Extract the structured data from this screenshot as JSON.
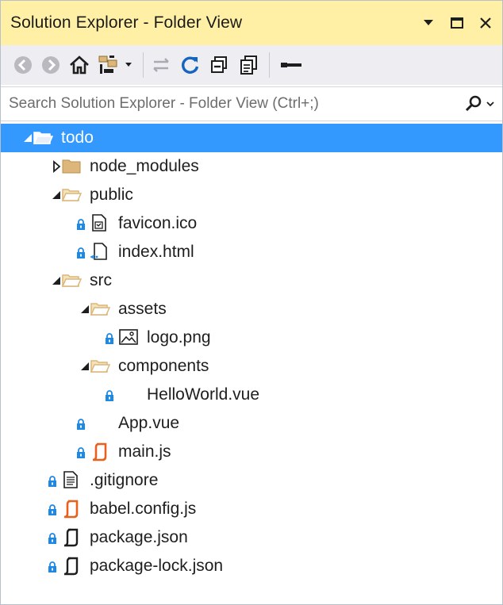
{
  "window": {
    "title": "Solution Explorer - Folder View",
    "controls": [
      "chevron-down-icon",
      "maximize-icon",
      "close-icon"
    ]
  },
  "toolbar": {
    "buttons": [
      "back-icon",
      "forward-icon",
      "home-icon",
      "switch-views-icon",
      "sync-icon",
      "refresh-icon",
      "collapse-all-icon",
      "show-all-files-icon",
      "properties-icon"
    ]
  },
  "search": {
    "placeholder": "Search Solution Explorer - Folder View (Ctrl+;)"
  },
  "tree": [
    {
      "label": "todo",
      "depth": 0,
      "kind": "folder-open",
      "expander": "expanded",
      "locked": false,
      "selected": true
    },
    {
      "label": "node_modules",
      "depth": 1,
      "kind": "folder-closed",
      "expander": "collapsed",
      "locked": false
    },
    {
      "label": "public",
      "depth": 1,
      "kind": "folder-open",
      "expander": "expanded",
      "locked": false
    },
    {
      "label": "favicon.ico",
      "depth": 2,
      "kind": "file-ico",
      "expander": "none",
      "locked": true
    },
    {
      "label": "index.html",
      "depth": 2,
      "kind": "file-html",
      "expander": "none",
      "locked": true
    },
    {
      "label": "src",
      "depth": 1,
      "kind": "folder-open",
      "expander": "expanded",
      "locked": false
    },
    {
      "label": "assets",
      "depth": 2,
      "kind": "folder-open",
      "expander": "expanded",
      "locked": false
    },
    {
      "label": "logo.png",
      "depth": 3,
      "kind": "file-image",
      "expander": "none",
      "locked": true
    },
    {
      "label": "components",
      "depth": 2,
      "kind": "folder-open",
      "expander": "expanded",
      "locked": false
    },
    {
      "label": "HelloWorld.vue",
      "depth": 3,
      "kind": "file-vue",
      "expander": "none",
      "locked": true
    },
    {
      "label": "App.vue",
      "depth": 2,
      "kind": "file-vue",
      "expander": "none",
      "locked": true
    },
    {
      "label": "main.js",
      "depth": 2,
      "kind": "file-js",
      "expander": "none",
      "locked": true
    },
    {
      "label": ".gitignore",
      "depth": 1,
      "kind": "file-text",
      "expander": "none",
      "locked": true
    },
    {
      "label": "babel.config.js",
      "depth": 1,
      "kind": "file-js",
      "expander": "none",
      "locked": true
    },
    {
      "label": "package.json",
      "depth": 1,
      "kind": "file-json",
      "expander": "none",
      "locked": true
    },
    {
      "label": "package-lock.json",
      "depth": 1,
      "kind": "file-json",
      "expander": "none",
      "locked": true
    }
  ],
  "colors": {
    "title_bar": "#fff0a5",
    "toolbar": "#eeeef2",
    "selection": "#3399ff",
    "folder": "#dcb67a",
    "js_accent": "#e8601c",
    "lock": "#1e88e5"
  }
}
